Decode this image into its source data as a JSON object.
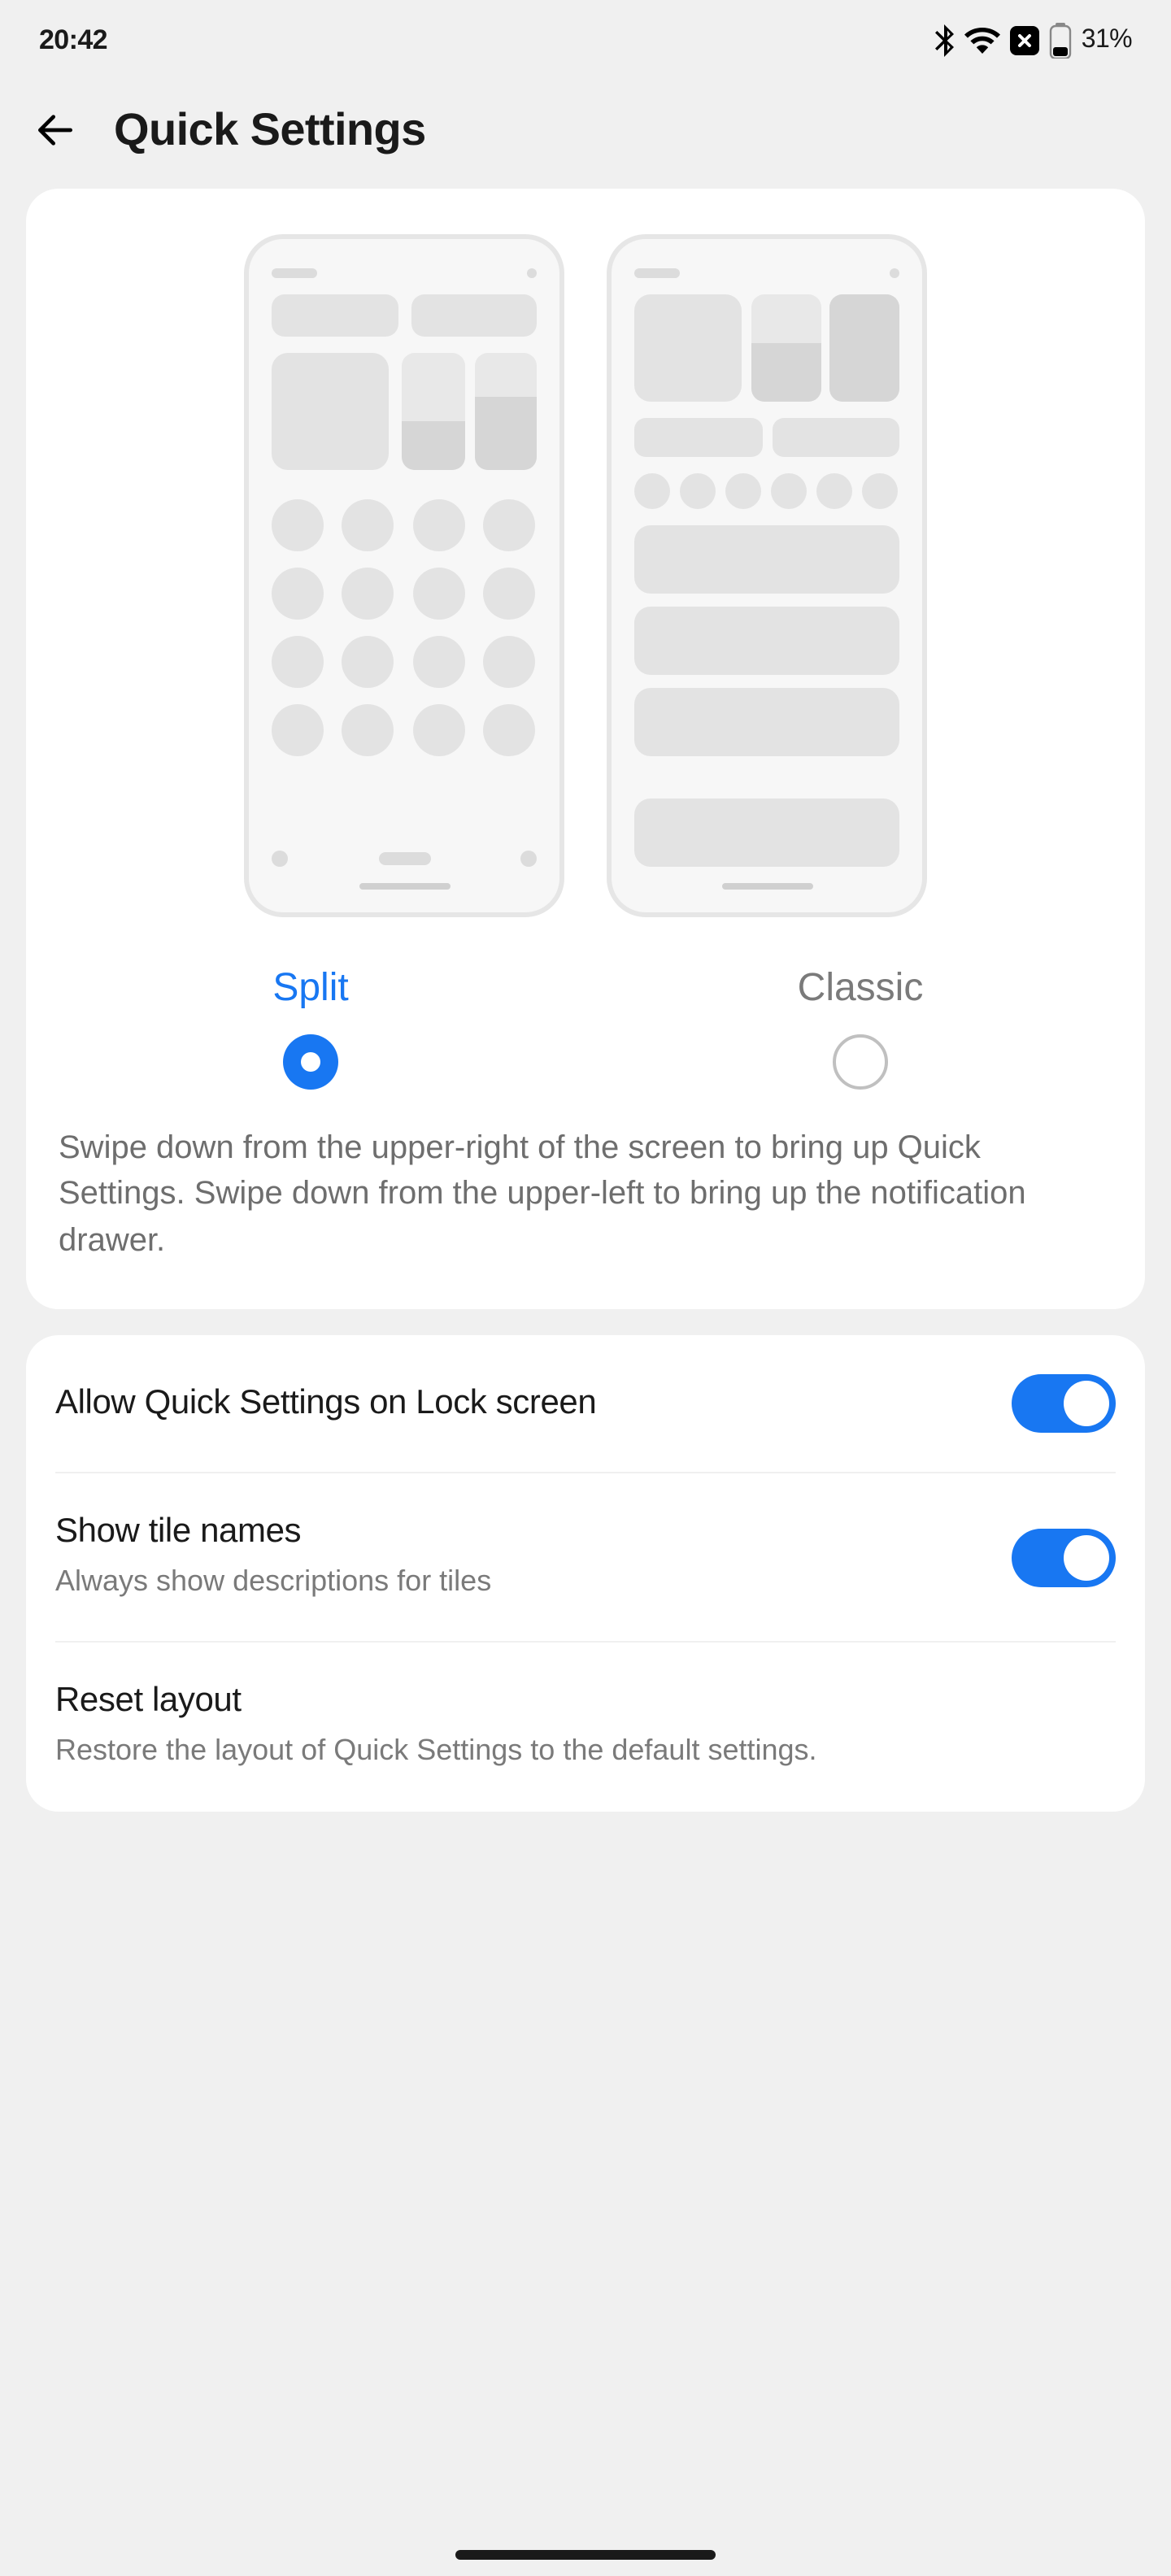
{
  "status": {
    "time": "20:42",
    "battery_pct": "31%"
  },
  "header": {
    "title": "Quick Settings"
  },
  "layout": {
    "options": {
      "split": "Split",
      "classic": "Classic"
    },
    "description": "Swipe down from the upper-right of the screen to bring up Quick Settings. Swipe down from the upper-left to bring up the notification drawer."
  },
  "settings": {
    "lock_screen": {
      "title": "Allow Quick Settings on Lock screen"
    },
    "tile_names": {
      "title": "Show tile names",
      "subtitle": "Always show descriptions for tiles"
    },
    "reset": {
      "title": "Reset layout",
      "subtitle": "Restore the layout of Quick Settings to the default settings."
    }
  }
}
